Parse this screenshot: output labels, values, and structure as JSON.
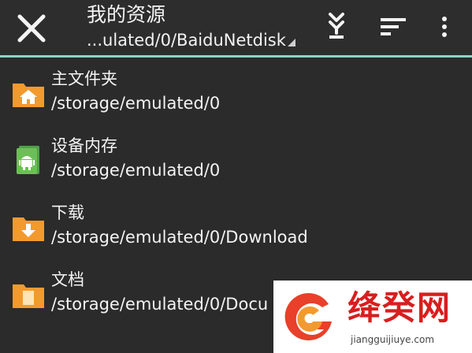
{
  "toolbar": {
    "title": "我的资源",
    "path": "...ulated/0/BaiduNetdisk",
    "icons": {
      "close": "close-icon",
      "download": "download-arrows-icon",
      "sort": "sort-lines-icon",
      "more": "more-vert-icon"
    },
    "accent_color": "#8fd3c4"
  },
  "locations": [
    {
      "name": "主文件夹",
      "path": "/storage/emulated/0",
      "icon": "home-folder-icon"
    },
    {
      "name": "设备内存",
      "path": "/storage/emulated/0",
      "icon": "android-storage-icon"
    },
    {
      "name": "下载",
      "path": "/storage/emulated/0/Download",
      "icon": "download-folder-icon"
    },
    {
      "name": "文档",
      "path": "/storage/emulated/0/Docu",
      "icon": "document-folder-icon"
    }
  ],
  "watermark": {
    "text": "绛癸网",
    "url": "jiangguijiuye.com"
  }
}
